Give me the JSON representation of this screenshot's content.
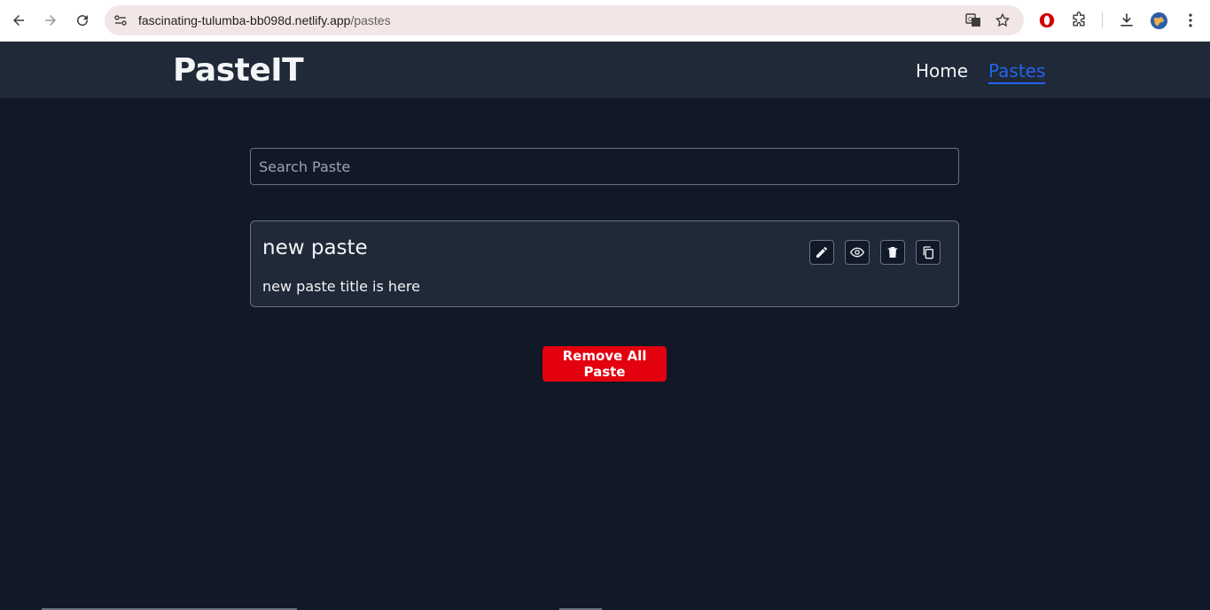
{
  "browser": {
    "url_host": "fascinating-tulumba-bb098d.netlify.app",
    "url_path": "/pastes"
  },
  "app": {
    "logo": "PasteIT",
    "nav": [
      {
        "label": "Home",
        "active": false
      },
      {
        "label": "Pastes",
        "active": true
      }
    ]
  },
  "search": {
    "placeholder": "Search Paste",
    "value": ""
  },
  "pastes": [
    {
      "title": "new paste",
      "content": "new paste title is here",
      "actions": [
        "pencil-icon",
        "eye-icon",
        "trash-icon",
        "copy-icon"
      ]
    }
  ],
  "remove_all_label": "Remove All Paste",
  "colors": {
    "page_bg": "#111827",
    "header_bg": "#1f2937",
    "active_link": "#2563eb",
    "danger": "#e3000f"
  }
}
